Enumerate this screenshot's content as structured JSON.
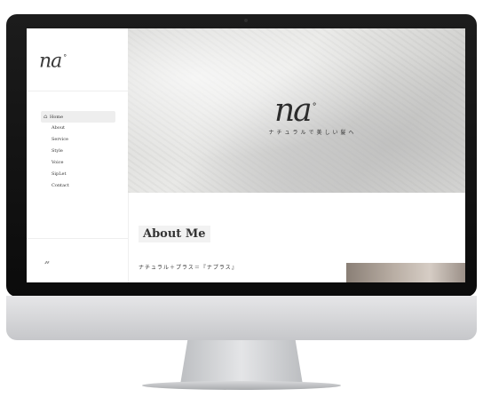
{
  "brand": {
    "logo_text": "na",
    "logo_mark": "°"
  },
  "sidebar": {
    "items": [
      {
        "label": "Home",
        "icon": "home-icon",
        "active": true
      },
      {
        "label": "About"
      },
      {
        "label": "Service"
      },
      {
        "label": "Style"
      },
      {
        "label": "Voice"
      },
      {
        "label": "SipLet"
      },
      {
        "label": "Contact"
      }
    ],
    "footer_email": ""
  },
  "hero": {
    "tagline": "ナチュラルで美しい髪へ",
    "icons": [
      "",
      "",
      ""
    ]
  },
  "about": {
    "heading": "About Me",
    "subheading": "ナチュラル＋プラス＝『ナプラス』"
  }
}
